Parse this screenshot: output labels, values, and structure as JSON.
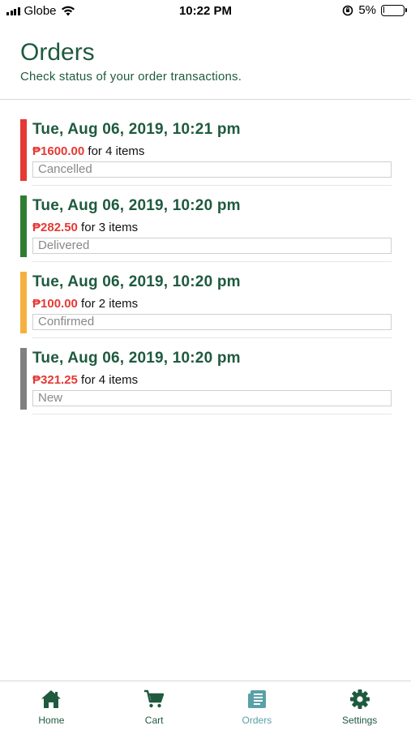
{
  "status_bar": {
    "carrier": "Globe",
    "time": "10:22 PM",
    "battery": "5%",
    "battery_level": 0.05
  },
  "header": {
    "title": "Orders",
    "subtitle": "Check status of your order transactions."
  },
  "orders": [
    {
      "date": "Tue, Aug 06, 2019, 10:21 pm",
      "amount": "₱1600.00",
      "items": " for 4 items",
      "status": "Cancelled",
      "status_color": "#e53935"
    },
    {
      "date": "Tue, Aug 06, 2019, 10:20 pm",
      "amount": "₱282.50",
      "items": " for 3 items",
      "status": "Delivered",
      "status_color": "#2e7d32"
    },
    {
      "date": "Tue, Aug 06, 2019, 10:20 pm",
      "amount": "₱100.00",
      "items": " for 2 items",
      "status": "Confirmed",
      "status_color": "#f5b041"
    },
    {
      "date": "Tue, Aug 06, 2019, 10:20 pm",
      "amount": "₱321.25",
      "items": " for 4 items",
      "status": "New",
      "status_color": "#808080"
    }
  ],
  "tabs": [
    {
      "label": "Home",
      "icon": "home-icon",
      "active": false
    },
    {
      "label": "Cart",
      "icon": "cart-icon",
      "active": false
    },
    {
      "label": "Orders",
      "icon": "orders-icon",
      "active": true
    },
    {
      "label": "Settings",
      "icon": "gear-icon",
      "active": false
    }
  ],
  "colors": {
    "primary": "#1f5a3f",
    "active_tab": "#5aa0a8",
    "price": "#e53935"
  }
}
